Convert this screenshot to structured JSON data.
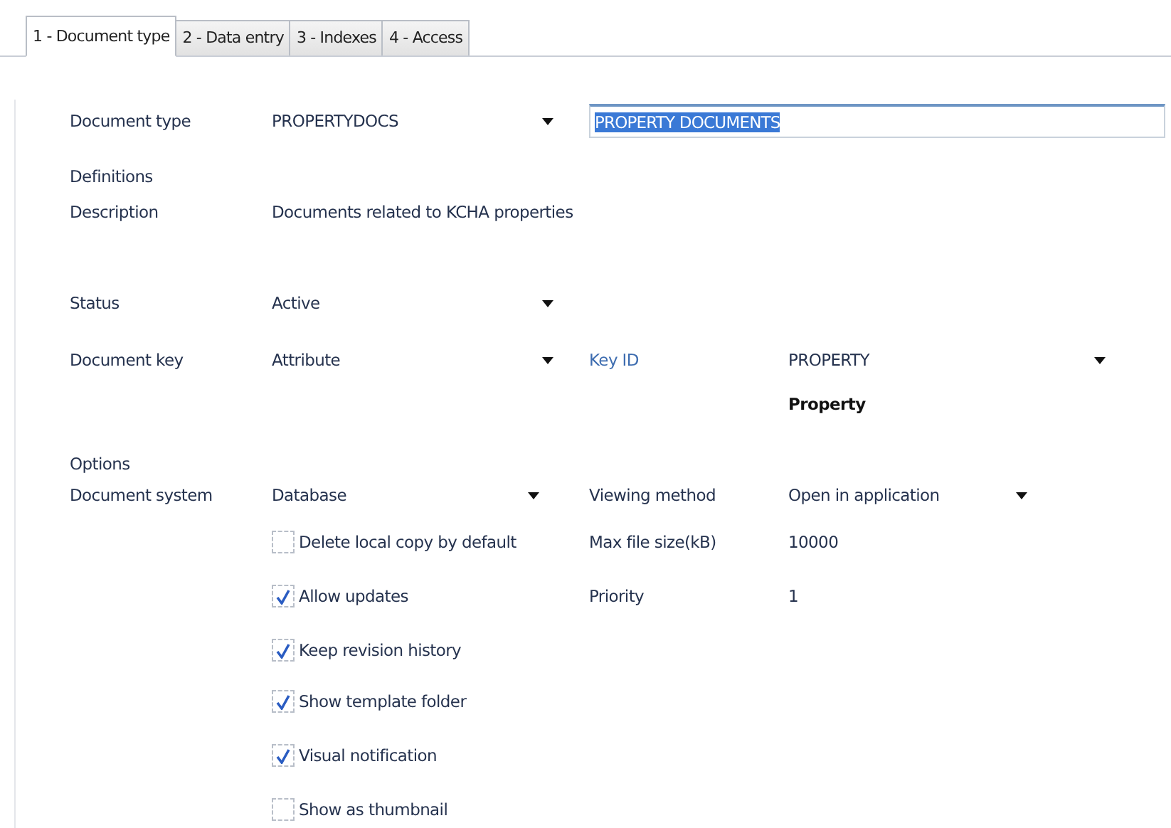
{
  "tabs": [
    {
      "label": "1 - Document type",
      "selected": true
    },
    {
      "label": "2 - Data entry",
      "selected": false
    },
    {
      "label": "3 - Indexes",
      "selected": false
    },
    {
      "label": "4 - Access",
      "selected": false
    }
  ],
  "document_type": {
    "label": "Document type",
    "value": "PROPERTYDOCS",
    "name_value": "PROPERTY DOCUMENTS",
    "name_selected": true
  },
  "definitions": {
    "heading": "Definitions",
    "description_label": "Description",
    "description": "Documents related to KCHA properties"
  },
  "status": {
    "label": "Status",
    "value": "Active"
  },
  "document_key": {
    "label": "Document key",
    "value": "Attribute",
    "key_id_label": "Key ID",
    "key_id_value": "PROPERTY",
    "key_id_name": "Property"
  },
  "options": {
    "heading": "Options",
    "document_system_label": "Document system",
    "document_system_value": "Database",
    "viewing_method_label": "Viewing method",
    "viewing_method_value": "Open in application",
    "max_file_size_label": "Max file size(kB)",
    "max_file_size_value": "10000",
    "priority_label": "Priority",
    "priority_value": "1",
    "checkboxes": [
      {
        "label": "Delete local copy by default",
        "checked": false
      },
      {
        "label": "Allow updates",
        "checked": true
      },
      {
        "label": "Keep revision history",
        "checked": true
      },
      {
        "label": "Show template folder",
        "checked": true
      },
      {
        "label": "Visual notification",
        "checked": true
      },
      {
        "label": "Show as thumbnail",
        "checked": false
      }
    ]
  }
}
